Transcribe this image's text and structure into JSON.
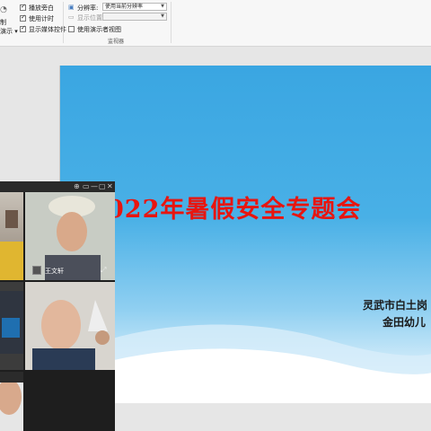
{
  "ribbon": {
    "left_fragments": {
      "item1": "制",
      "item2": "演示 ▾"
    },
    "checkboxes": [
      {
        "label": "播放旁白",
        "checked": true
      },
      {
        "label": "使用计时",
        "checked": true
      },
      {
        "label": "显示媒体控件",
        "checked": true
      }
    ],
    "monitor": {
      "resolution_label": "分辨率:",
      "resolution_value": "使用当前分辨率",
      "display_label": "显示位置:",
      "display_value": "",
      "presenter_view_label": "使用演示者视图",
      "presenter_view_checked": false,
      "group_title": "监视器"
    }
  },
  "slide": {
    "title": "022年暑假安全专题会",
    "sub1": "灵武市白土岗",
    "sub2": "金田幼儿",
    "colors": {
      "title": "#e8150f",
      "bg_top": "#3aa6e2"
    }
  },
  "video_panel": {
    "controls": [
      "⊕",
      "▭",
      "—",
      "▢",
      "✕"
    ],
    "participant_name": "王文轩"
  }
}
